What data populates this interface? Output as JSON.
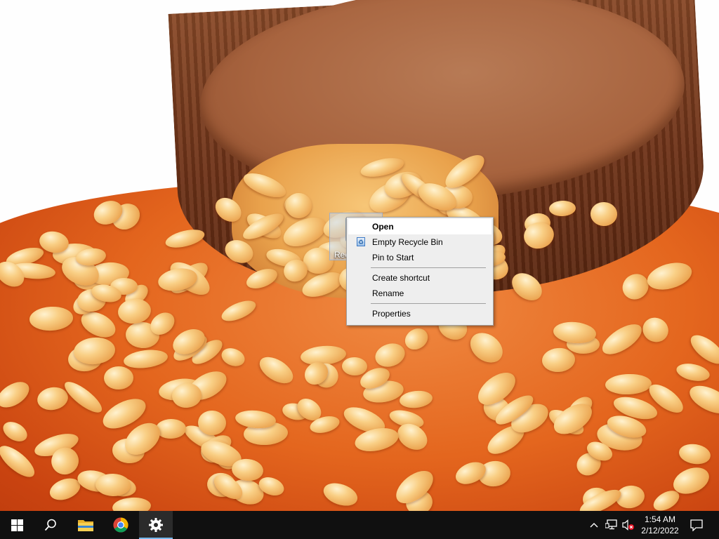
{
  "desktop": {
    "recycle_bin_label": "Rec"
  },
  "context_menu": {
    "items": [
      {
        "label": "Open",
        "bold": true
      },
      {
        "label": "Empty Recycle Bin",
        "icon": "recycle-bin-icon"
      },
      {
        "label": "Pin to Start"
      },
      {
        "label": "Create shortcut"
      },
      {
        "label": "Rename"
      },
      {
        "label": "Properties"
      }
    ]
  },
  "taskbar": {
    "start_icon": "windows-logo-icon",
    "search_icon": "search-icon",
    "apps": [
      {
        "name": "File Explorer",
        "icon": "folder-icon"
      },
      {
        "name": "Google Chrome",
        "icon": "chrome-icon"
      },
      {
        "name": "Settings",
        "icon": "gear-icon",
        "active": true
      }
    ],
    "tray": {
      "chevron_icon": "chevron-up-icon",
      "network_icon": "network-icon",
      "volume_icon": "volume-muted-icon",
      "notification_icon": "action-center-icon"
    },
    "clock": {
      "time": "1:54 AM",
      "date": "2/12/2022"
    }
  },
  "colors": {
    "taskbar_bg": "#101010",
    "menu_bg": "#eeeeee",
    "active_indicator": "#76b9ed"
  }
}
